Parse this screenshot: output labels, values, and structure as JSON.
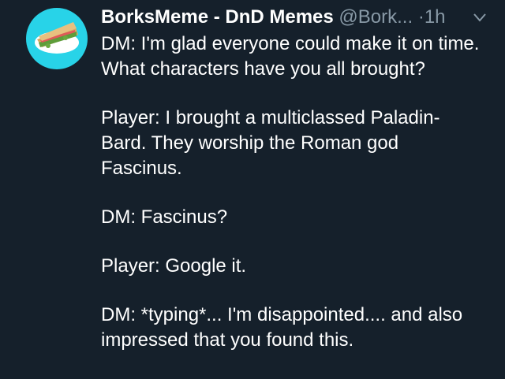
{
  "tweet": {
    "display_name": "BorksMeme - DnD Memes",
    "handle": "@Bork...",
    "separator": "·",
    "time": "1h",
    "avatar_icon": "sandwich-icon",
    "menu_icon": "chevron-down-icon",
    "paragraphs": [
      "DM: I'm glad everyone could make it on time. What characters have you all brought?",
      "Player: I brought a multiclassed Paladin-Bard. They worship the Roman god Fascinus.",
      "DM: Fascinus?",
      "Player: Google it.",
      "DM: *typing*... I'm disappointed.... and also impressed that you found this."
    ]
  },
  "colors": {
    "background": "#15202b",
    "text_primary": "#ffffff",
    "text_secondary": "#8899a6",
    "avatar_bg": "#28d3e8"
  }
}
